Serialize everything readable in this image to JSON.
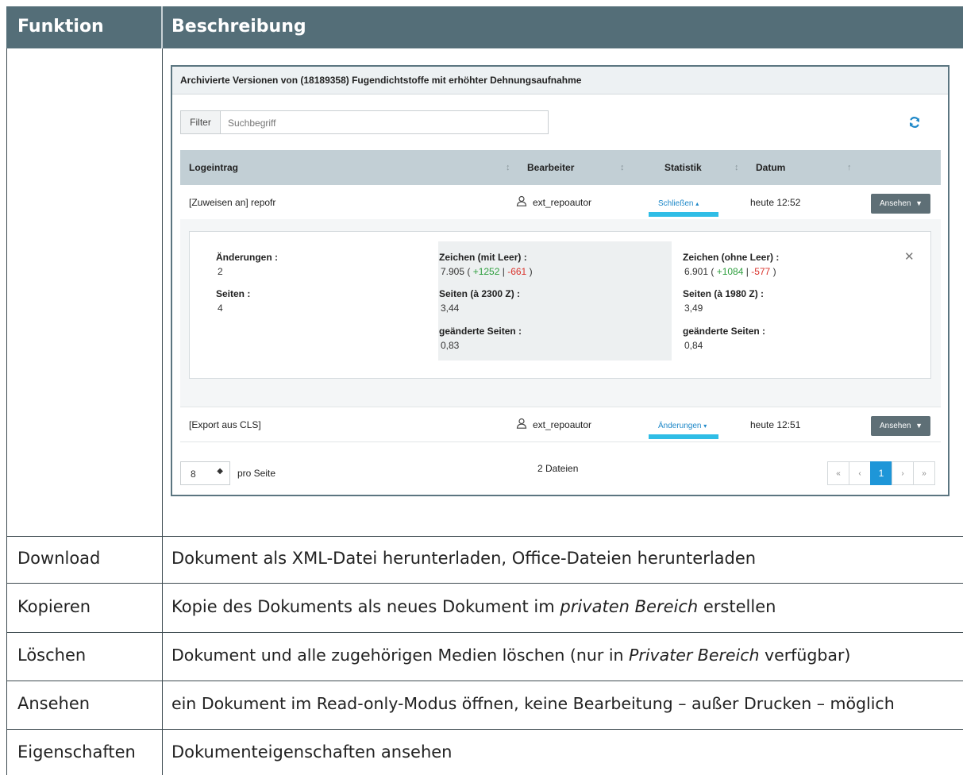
{
  "table": {
    "col1_header": "Funktion",
    "col2_header": "Beschreibung",
    "rows": [
      {
        "name": "Download",
        "desc_parts": [
          "Dokument als XML-Datei herunterladen, Office-Dateien herunterladen"
        ]
      },
      {
        "name": "Kopieren",
        "desc_parts": [
          "Kopie des Dokuments als neues Dokument im ",
          "privaten Bereich",
          " erstellen"
        ]
      },
      {
        "name": "Löschen",
        "desc_parts": [
          "Dokument und alle zugehörigen Medien löschen (nur in ",
          "Privater Bereich",
          " verfügbar)"
        ]
      },
      {
        "name": "Ansehen",
        "desc_parts": [
          "ein Dokument im Read-only-Modus öffnen, keine Bearbeitung – außer Drucken – möglich"
        ]
      },
      {
        "name": "Eigenschaften",
        "desc_parts": [
          "Dokumenteigenschaften ansehen"
        ]
      }
    ]
  },
  "screenshot": {
    "title": "Archivierte Versionen von (18189358) Fugendichtstoffe mit erhöhter Dehnungsaufnahme",
    "filter_label": "Filter",
    "filter_placeholder": "Suchbegriff",
    "icons": {
      "refresh": "refresh-icon",
      "user": "user-icon",
      "sort": "sort-icon"
    },
    "columns": [
      "Logeintrag",
      "Bearbeiter",
      "Statistik",
      "Datum"
    ],
    "rows": [
      {
        "log": "[Zuweisen an] repofr",
        "user": "ext_repoautor",
        "stat_toggle": "Schließen",
        "stat_caret": "▴",
        "date": "heute 12:52",
        "button": "Ansehen"
      },
      {
        "log": "[Export aus CLS]",
        "user": "ext_repoautor",
        "stat_toggle": "Änderungen",
        "stat_caret": "▾",
        "date": "heute 12:51",
        "button": "Ansehen"
      }
    ],
    "stats": {
      "changes_label": "Änderungen :",
      "changes_value": "2",
      "pages_label": "Seiten :",
      "pages_value": "4",
      "chars_with_label": "Zeichen (mit Leer) :",
      "chars_with_value": "7.905",
      "chars_with_plus": "+1252",
      "chars_with_minus": "-661",
      "pages_2300_label": "Seiten (à 2300 Z) :",
      "pages_2300_value": "3,44",
      "changed_pages_label": "geänderte Seiten :",
      "changed_pages_mid_value": "0,83",
      "chars_without_label": "Zeichen (ohne Leer) :",
      "chars_without_value": "6.901",
      "chars_without_plus": "+1084",
      "chars_without_minus": "-577",
      "pages_1980_label": "Seiten (à 1980 Z) :",
      "pages_1980_value": "3,49",
      "changed_pages_right_value": "0,84"
    },
    "footer": {
      "per_page_value": "8",
      "per_page_label": "pro Seite",
      "file_count": "2 Dateien",
      "pager": [
        "«",
        "‹",
        "1",
        "›",
        "»"
      ],
      "current_page": "1"
    }
  }
}
